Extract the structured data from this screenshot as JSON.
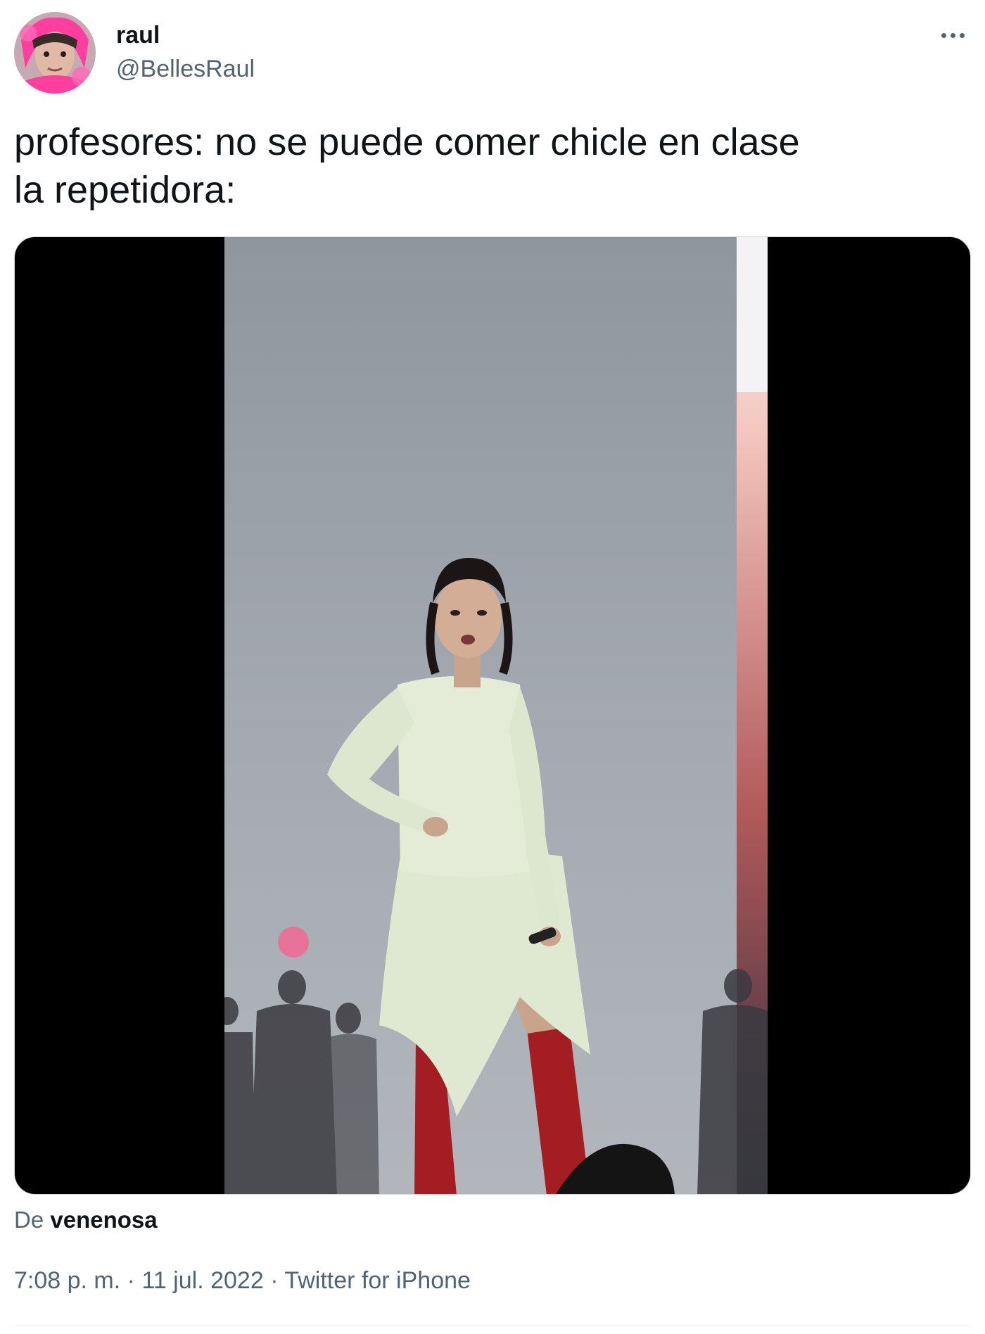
{
  "user": {
    "display_name": "raul",
    "handle": "@BellesRaul",
    "avatar_icon": "profile-photo"
  },
  "more_icon": "ellipsis-icon",
  "tweet": {
    "lines": [
      "profesores: no se puede comer chicle en clase",
      "la repetidora:"
    ]
  },
  "media": {
    "type": "video",
    "description_icon": "concert-video-thumbnail"
  },
  "attribution": {
    "prefix": "De",
    "author": "venenosa"
  },
  "meta": {
    "time": "7:08 p. m.",
    "separator": "·",
    "date": "11 jul. 2022",
    "source": "Twitter for iPhone"
  },
  "colors": {
    "text_primary": "#0f1419",
    "text_secondary": "#536471",
    "media_background": "#000000",
    "stage_backdrop": "#a3a8b0",
    "accent_pink": "#ff3fa0"
  }
}
